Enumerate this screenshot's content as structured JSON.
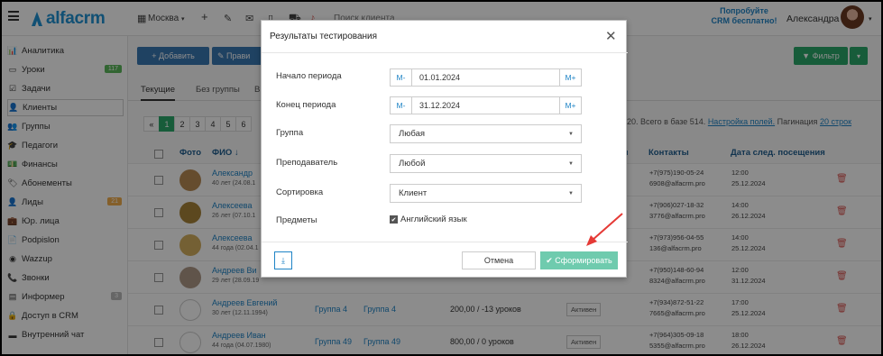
{
  "topbar": {
    "logo": "alfacrm",
    "city": "Москва",
    "search_placeholder": "Поиск клиента",
    "try_crm_line1": "Попробуйте",
    "try_crm_line2": "CRM бесплатно!",
    "user": "Александра"
  },
  "sidebar": {
    "items": [
      {
        "icon": "📊",
        "label": "Аналитика"
      },
      {
        "icon": "▭",
        "label": "Уроки",
        "badge": "117",
        "badge_color": "#5cb85c"
      },
      {
        "icon": "☑",
        "label": "Задачи"
      },
      {
        "icon": "👤",
        "label": "Клиенты"
      },
      {
        "icon": "👥",
        "label": "Группы"
      },
      {
        "icon": "🎓",
        "label": "Педагоги"
      },
      {
        "icon": "💵",
        "label": "Финансы"
      },
      {
        "icon": "🏷",
        "label": "Абонементы"
      },
      {
        "icon": "👤",
        "label": "Лиды",
        "badge": "21",
        "badge_color": "#f0ad4e"
      },
      {
        "icon": "💼",
        "label": "Юр. лица"
      },
      {
        "icon": "📄",
        "label": "Podpislon"
      },
      {
        "icon": "◉",
        "label": "Wazzup"
      },
      {
        "icon": "📞",
        "label": "Звонки"
      },
      {
        "icon": "▤",
        "label": "Информер",
        "badge": "3",
        "badge_color": "#bbbbbb"
      },
      {
        "icon": "🔒",
        "label": "Доступ в CRM"
      },
      {
        "icon": "▬",
        "label": "Внутренний чат"
      }
    ]
  },
  "toolbar": {
    "add_label": "+ Добавить",
    "add2_label": "✎ Прави",
    "filter_label": "▼ Фильтр",
    "filter_caret": "▾"
  },
  "tabs": [
    "Текущие",
    "Без группы",
    "В"
  ],
  "pager": [
    "«",
    "1",
    "2",
    "3",
    "4",
    "5",
    "6"
  ],
  "counts": {
    "text": "20. Всего в базе 514.",
    "settings_link": "Настройка полей.",
    "pagination_label": "Пагинация",
    "pagination_value": "20 строк"
  },
  "table": {
    "headers": {
      "photo": "Фото",
      "name": "ФИО ↓",
      "short": "я",
      "contacts": "Контакты",
      "next_visit": "Дата след. посещения"
    },
    "rows": [
      {
        "name": "Александр",
        "age": "40 лет (24.08.1",
        "group1": "",
        "group2": "",
        "balance": "",
        "status": "",
        "phone": "+7(975)190-05-24",
        "email": "6908@alfacrm.pro",
        "time": "12:00",
        "date": "25.12.2024",
        "photo": "#b98a55"
      },
      {
        "name": "Алексеева",
        "age": "26 лет (07.10.1",
        "group1": "",
        "group2": "",
        "balance": "",
        "status": "",
        "phone": "+7(906)027-18-32",
        "email": "3776@alfacrm.pro",
        "time": "14:00",
        "date": "26.12.2024",
        "photo": "#a8843a"
      },
      {
        "name": "Алексеева",
        "age": "44 года (02.04.1",
        "group1": "",
        "group2": "",
        "balance": "",
        "status": "",
        "phone": "+7(973)956-04-55",
        "email": "136@alfacrm.pro",
        "time": "14:00",
        "date": "25.12.2024",
        "photo": "#d4b060"
      },
      {
        "name": "Андреев Ви",
        "age": "29 лет (28.09.19",
        "group1": "",
        "group2": "",
        "balance": "",
        "status": "",
        "phone": "+7(950)148-60-94",
        "email": "8324@alfacrm.pro",
        "time": "12:00",
        "date": "31.12.2024",
        "photo": "#b09a88"
      },
      {
        "name": "Андреев Евгений",
        "age": "30 лет (12.11.1994)",
        "group1": "Группа 4",
        "group2": "Группа 4",
        "balance": "200,00 / -13 уроков",
        "status": "Активен",
        "phone": "+7(934)872-51-22",
        "email": "7665@alfacrm.pro",
        "time": "17:00",
        "date": "25.12.2024",
        "photo": ""
      },
      {
        "name": "Андреев Иван",
        "age": "44 года (04.07.1980)",
        "group1": "Группа 49",
        "group2": "Группа 49",
        "balance": "800,00 / 0 уроков",
        "status": "Активен",
        "phone": "+7(964)305-09-18",
        "email": "5355@alfacrm.pro",
        "time": "18:00",
        "date": "26.12.2024",
        "photo": ""
      }
    ]
  },
  "modal": {
    "title": "Результаты тестирования",
    "close": "✕",
    "period_start_label": "Начало периода",
    "period_start_value": "01.01.2024",
    "period_end_label": "Конец периода",
    "period_end_value": "31.12.2024",
    "minus": "M-",
    "plus": "M+",
    "group_label": "Группа",
    "group_value": "Любая",
    "teacher_label": "Преподаватель",
    "teacher_value": "Любой",
    "sort_label": "Сортировка",
    "sort_value": "Клиент",
    "subjects_label": "Предметы",
    "subject_value": "Английский язык",
    "download": "⤓",
    "cancel": "Отмена",
    "submit": "✔ Сформировать"
  },
  "colors": {
    "accent": "#1f84c6",
    "green": "#2aa86a",
    "submit": "#6fcbae",
    "arrow": "#e53935"
  }
}
